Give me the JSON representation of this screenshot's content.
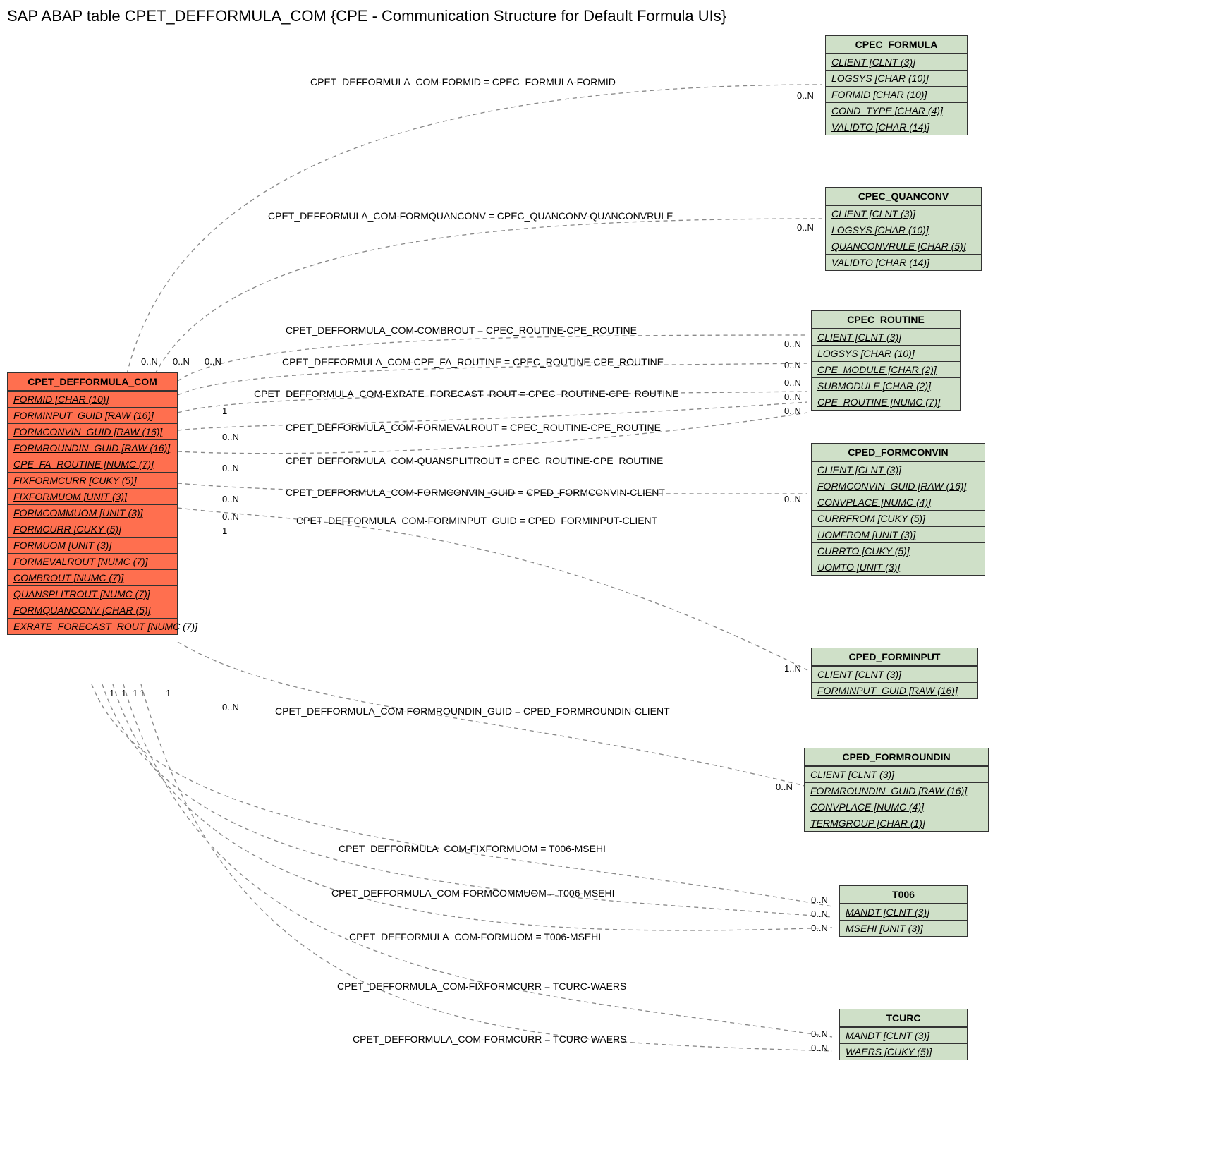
{
  "title": "SAP ABAP table CPET_DEFFORMULA_COM {CPE - Communication Structure for Default Formula UIs}",
  "main_table": {
    "name": "CPET_DEFFORMULA_COM",
    "fields": [
      "FORMID [CHAR (10)]",
      "FORMINPUT_GUID [RAW (16)]",
      "FORMCONVIN_GUID [RAW (16)]",
      "FORMROUNDIN_GUID [RAW (16)]",
      "CPE_FA_ROUTINE [NUMC (7)]",
      "FIXFORMCURR [CUKY (5)]",
      "FIXFORMUOM [UNIT (3)]",
      "FORMCOMMUOM [UNIT (3)]",
      "FORMCURR [CUKY (5)]",
      "FORMUOM [UNIT (3)]",
      "FORMEVALROUT [NUMC (7)]",
      "COMBROUT [NUMC (7)]",
      "QUANSPLITROUT [NUMC (7)]",
      "FORMQUANCONV [CHAR (5)]",
      "EXRATE_FORECAST_ROUT [NUMC (7)]"
    ]
  },
  "ref_tables": [
    {
      "name": "CPEC_FORMULA",
      "fields": [
        "CLIENT [CLNT (3)]",
        "LOGSYS [CHAR (10)]",
        "FORMID [CHAR (10)]",
        "COND_TYPE [CHAR (4)]",
        "VALIDTO [CHAR (14)]"
      ]
    },
    {
      "name": "CPEC_QUANCONV",
      "fields": [
        "CLIENT [CLNT (3)]",
        "LOGSYS [CHAR (10)]",
        "QUANCONVRULE [CHAR (5)]",
        "VALIDTO [CHAR (14)]"
      ]
    },
    {
      "name": "CPEC_ROUTINE",
      "fields": [
        "CLIENT [CLNT (3)]",
        "LOGSYS [CHAR (10)]",
        "CPE_MODULE [CHAR (2)]",
        "SUBMODULE [CHAR (2)]",
        "CPE_ROUTINE [NUMC (7)]"
      ]
    },
    {
      "name": "CPED_FORMCONVIN",
      "fields": [
        "CLIENT [CLNT (3)]",
        "FORMCONVIN_GUID [RAW (16)]",
        "CONVPLACE [NUMC (4)]",
        "CURRFROM [CUKY (5)]",
        "UOMFROM [UNIT (3)]",
        "CURRTO [CUKY (5)]",
        "UOMTO [UNIT (3)]"
      ]
    },
    {
      "name": "CPED_FORMINPUT",
      "fields": [
        "CLIENT [CLNT (3)]",
        "FORMINPUT_GUID [RAW (16)]"
      ]
    },
    {
      "name": "CPED_FORMROUNDIN",
      "fields": [
        "CLIENT [CLNT (3)]",
        "FORMROUNDIN_GUID [RAW (16)]",
        "CONVPLACE [NUMC (4)]",
        "TERMGROUP [CHAR (1)]"
      ]
    },
    {
      "name": "T006",
      "fields": [
        "MANDT [CLNT (3)]",
        "MSEHI [UNIT (3)]"
      ]
    },
    {
      "name": "TCURC",
      "fields": [
        "MANDT [CLNT (3)]",
        "WAERS [CUKY (5)]"
      ]
    }
  ],
  "relations": [
    "CPET_DEFFORMULA_COM-FORMID = CPEC_FORMULA-FORMID",
    "CPET_DEFFORMULA_COM-FORMQUANCONV = CPEC_QUANCONV-QUANCONVRULE",
    "CPET_DEFFORMULA_COM-COMBROUT = CPEC_ROUTINE-CPE_ROUTINE",
    "CPET_DEFFORMULA_COM-CPE_FA_ROUTINE = CPEC_ROUTINE-CPE_ROUTINE",
    "CPET_DEFFORMULA_COM-EXRATE_FORECAST_ROUT = CPEC_ROUTINE-CPE_ROUTINE",
    "CPET_DEFFORMULA_COM-FORMEVALROUT = CPEC_ROUTINE-CPE_ROUTINE",
    "CPET_DEFFORMULA_COM-QUANSPLITROUT = CPEC_ROUTINE-CPE_ROUTINE",
    "CPET_DEFFORMULA_COM-FORMCONVIN_GUID = CPED_FORMCONVIN-CLIENT",
    "CPET_DEFFORMULA_COM-FORMINPUT_GUID = CPED_FORMINPUT-CLIENT",
    "CPET_DEFFORMULA_COM-FORMROUNDIN_GUID = CPED_FORMROUNDIN-CLIENT",
    "CPET_DEFFORMULA_COM-FIXFORMUOM = T006-MSEHI",
    "CPET_DEFFORMULA_COM-FORMCOMMUOM = T006-MSEHI",
    "CPET_DEFFORMULA_COM-FORMUOM = T006-MSEHI",
    "CPET_DEFFORMULA_COM-FIXFORMCURR = TCURC-WAERS",
    "CPET_DEFFORMULA_COM-FORMCURR = TCURC-WAERS"
  ],
  "cardinalities": {
    "n0": "0..N",
    "one": "1",
    "r1n": "1..N",
    "main_left": [
      "0..N",
      "0..N",
      "0..N",
      "1",
      "0..N",
      "0..N",
      "0..N",
      "0..N",
      "1",
      "0..N"
    ],
    "main_bottom": [
      "1",
      "1",
      "1",
      "1",
      "1"
    ]
  }
}
